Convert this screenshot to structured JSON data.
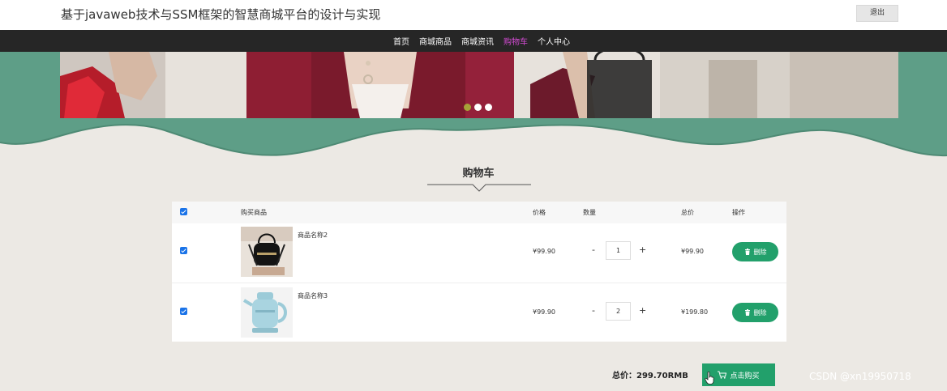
{
  "header": {
    "site_title": "基于javaweb技术与SSM框架的智慧商城平台的设计与实现",
    "logout_label": "退出"
  },
  "nav": {
    "items": [
      {
        "label": "首页"
      },
      {
        "label": "商城商品"
      },
      {
        "label": "商城资讯"
      },
      {
        "label": "购物车",
        "active": true
      },
      {
        "label": "个人中心"
      }
    ],
    "active_color": "#d24bd2"
  },
  "carousel": {
    "dots": 3,
    "active_index": 0,
    "active_color": "#a6a338"
  },
  "cart": {
    "title": "购物车",
    "columns": {
      "product": "购买商品",
      "price": "价格",
      "quantity": "数量",
      "total": "总价",
      "action": "操作"
    },
    "rows": [
      {
        "name": "商品名称2",
        "price": "¥99.90",
        "minus": "-",
        "qty": "1",
        "plus": "+",
        "subtotal": "¥99.90",
        "delete_label": "删除",
        "checked": true
      },
      {
        "name": "商品名称3",
        "price": "¥99.90",
        "minus": "-",
        "qty": "2",
        "plus": "+",
        "subtotal": "¥199.80",
        "delete_label": "删除",
        "checked": true
      }
    ],
    "total_text": "总价：299.70RMB",
    "buy_label": "点击购买"
  },
  "watermark": "CSDN @xn19950718",
  "colors": {
    "nav_bg": "#262626",
    "green": "#22a06b",
    "hero_green": "#5e9e87"
  }
}
